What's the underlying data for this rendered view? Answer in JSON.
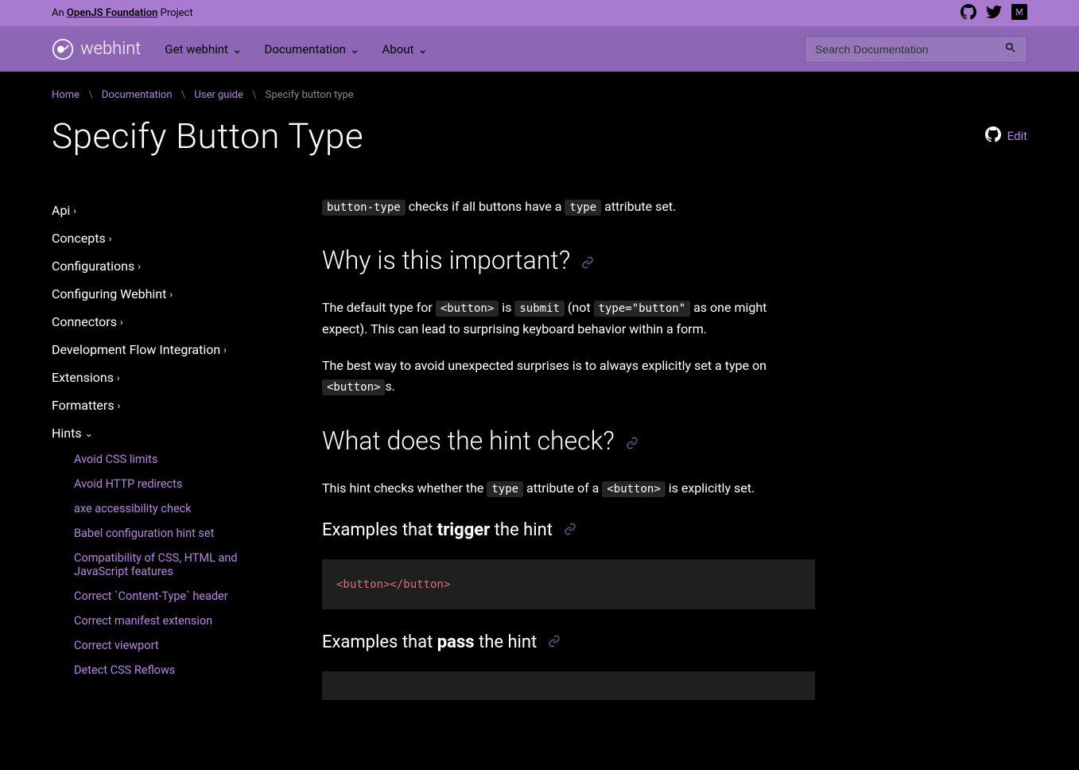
{
  "topbar": {
    "prefix": "An ",
    "link": "OpenJS Foundation",
    "suffix": " Project"
  },
  "brand": "webhint",
  "nav": {
    "get": "Get webhint",
    "docs": "Documentation",
    "about": "About"
  },
  "search": {
    "placeholder": "Search Documentation"
  },
  "breadcrumb": {
    "home": "Home",
    "docs": "Documentation",
    "guide": "User guide",
    "current": "Specify button type"
  },
  "title": "Specify Button Type",
  "edit": "Edit",
  "sidebar": {
    "items": [
      "Api",
      "Concepts",
      "Configurations",
      "Configuring Webhint",
      "Connectors",
      "Development Flow Integration",
      "Extensions",
      "Formatters",
      "Hints"
    ],
    "hints": [
      "Avoid CSS limits",
      "Avoid HTTP redirects",
      "axe accessibility check",
      "Babel configuration hint set",
      "Compatibility of CSS, HTML and JavaScript features",
      "Correct `Content-Type` header",
      "Correct manifest extension",
      "Correct viewport",
      "Detect CSS Reflows"
    ]
  },
  "article": {
    "intro": {
      "c1": "button-type",
      "t1": " checks if all buttons have a ",
      "c2": "type",
      "t2": " attribute set."
    },
    "h_why": "Why is this important?",
    "why1": {
      "t1": "The default type for ",
      "c1": "<button>",
      "t2": " is ",
      "c2": "submit",
      "t3": " (not ",
      "c3": "type=\"button\"",
      "t4": " as one might expect). This can lead to surprising keyboard behavior within a form."
    },
    "why2": {
      "t1": "The best way to avoid unexpected surprises is to always explicitly set a type on ",
      "c1": "<button>",
      "t2": "s."
    },
    "h_what": "What does the hint check?",
    "what": {
      "t1": "This hint checks whether the ",
      "c1": "type",
      "t2": " attribute of a ",
      "c2": "<button>",
      "t3": " is explicitly set."
    },
    "h_trigger_pre": "Examples that ",
    "h_trigger_bold": "trigger",
    "h_trigger_post": " the hint",
    "code_trigger": "<button></button>",
    "h_pass_pre": "Examples that ",
    "h_pass_bold": "pass",
    "h_pass_post": " the hint"
  }
}
